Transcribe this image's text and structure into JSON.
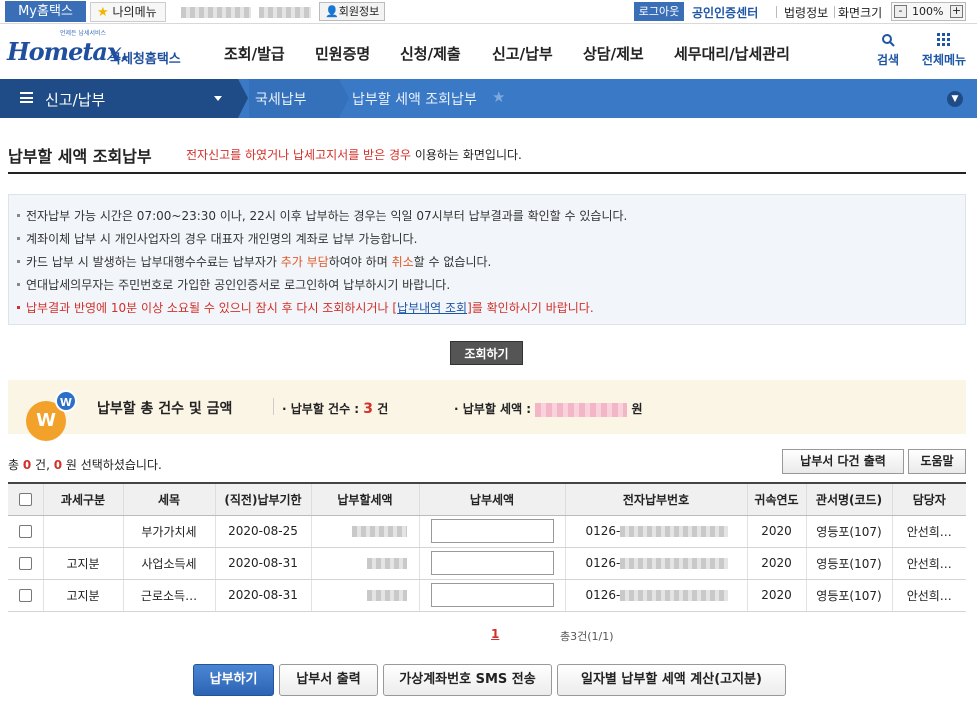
{
  "top": {
    "my_hometax": "My홈택스",
    "my_menu": "나의메뉴",
    "member_info": "회원정보",
    "logout": "로그아웃",
    "cert_center": "공인인증센터",
    "law_info": "법령정보",
    "screen_size": "화면크기",
    "zoom": "100%",
    "zoom_minus": "-",
    "zoom_plus": "+"
  },
  "logo": {
    "small": "언제든 납세서비스",
    "hometax": "Hometax.",
    "nts": "국세청홈택스"
  },
  "nav": [
    "조회/발급",
    "민원증명",
    "신청/제출",
    "신고/납부",
    "상담/제보",
    "세무대리/납세관리"
  ],
  "utility": {
    "search": "검색",
    "all_menu": "전체메뉴"
  },
  "breadcrumb": {
    "menu": "신고/납부",
    "level2": "국세납부",
    "level3": "납부할 세액 조회납부"
  },
  "page": {
    "title": "납부할 세액 조회납부",
    "desc_red": "전자신고를 하였거나 납세고지서를 받은 경우",
    "desc_rest": " 이용하는 화면입니다."
  },
  "notice": {
    "line1": "전자납부 가능 시간은 07:00~23:30 이나, 22시 이후 납부하는 경우는 익일 07시부터 납부결과를 확인할 수 있습니다.",
    "line2": "계좌이체 납부 시 개인사업자의 경우 대표자 개인명의 계좌로 납부 가능합니다.",
    "line3_a": "카드 납부 시 발생하는 납부대행수수료는 납부자가 ",
    "line3_b": "추가 부담",
    "line3_c": "하여야 하며 ",
    "line3_d": "취소",
    "line3_e": "할 수 없습니다.",
    "line4": "연대납세의무자는 주민번호로 가입한 공인인증서로 로그인하여 납부하시기 바랍니다.",
    "line5_a": "납부결과 반영에 10분 이상 소요될 수 있으니 잠시 후 다시 조회하시거나 [",
    "line5_link": "납부내역 조회",
    "line5_b": "]를 확인하시기 바랍니다."
  },
  "query_button": "조회하기",
  "summary": {
    "title": "납부할 총 건수 및 금액",
    "count_label": "납부할 건수 :",
    "count": "3",
    "count_unit": "건",
    "amount_label": "납부할 세액 :",
    "amount_unit": "원",
    "w1": "W",
    "w2": "W"
  },
  "selection": {
    "pre": "총 ",
    "total": "0",
    "mid": " 건, ",
    "amount": "0",
    "post": " 원 선택하셨습니다."
  },
  "buttons": {
    "multi_print": "납부서 다건 출력",
    "help": "도움말"
  },
  "table": {
    "headers": [
      "",
      "과세구분",
      "세목",
      "(직전)납부기한",
      "납부할세액",
      "납부세액",
      "전자납부번호",
      "귀속연도",
      "관서명(코드)",
      "담당자"
    ],
    "rows": [
      {
        "type": "",
        "tax": "부가가치세",
        "due": "2020-08-25",
        "epay": "0126-",
        "year": "2020",
        "office": "영등포(107)",
        "staff": "안선희…"
      },
      {
        "type": "고지분",
        "tax": "사업소득세",
        "due": "2020-08-31",
        "epay": "0126-",
        "year": "2020",
        "office": "영등포(107)",
        "staff": "안선희…"
      },
      {
        "type": "고지분",
        "tax": "근로소득…",
        "due": "2020-08-31",
        "epay": "0126-",
        "year": "2020",
        "office": "영등포(107)",
        "staff": "안선희…"
      }
    ]
  },
  "paging": {
    "page": "1",
    "count": "총3건(1/1)"
  },
  "bottom_buttons": [
    "납부하기",
    "납부서 출력",
    "가상계좌번호 SMS 전송",
    "일자별 납부할 세액 계산(고지분)"
  ],
  "colors": {
    "brand": "#3a6fb8",
    "nav_dark": "#1f4c86",
    "accent_red": "#d2302a"
  }
}
